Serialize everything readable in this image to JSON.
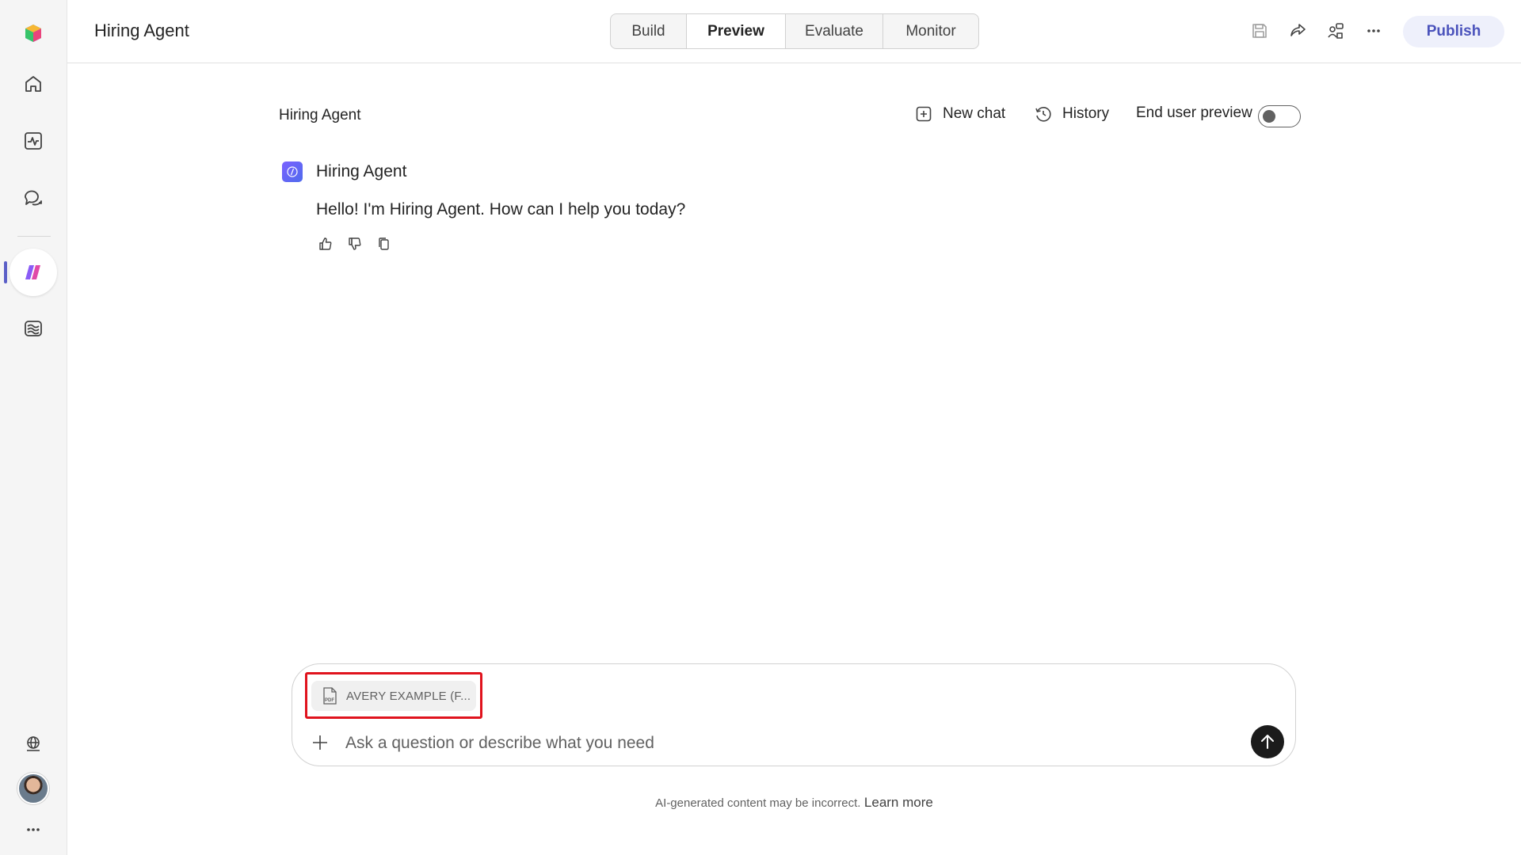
{
  "app": {
    "title": "Hiring Agent"
  },
  "tabs": [
    {
      "label": "Build",
      "active": false
    },
    {
      "label": "Preview",
      "active": true
    },
    {
      "label": "Evaluate",
      "active": false
    },
    {
      "label": "Monitor",
      "active": false
    }
  ],
  "toolbar": {
    "icons": [
      "save-icon",
      "share-icon",
      "connect-icon",
      "more-icon"
    ],
    "publish_label": "Publish"
  },
  "sidebar": {
    "items": [
      "copilot-logo-icon",
      "home-icon",
      "activity-icon",
      "chat-icon",
      "agent-icon",
      "library-icon",
      "globe-icon",
      "avatar",
      "more-icon"
    ],
    "active": "agent-icon"
  },
  "chat_header": {
    "title": "Hiring Agent",
    "new_chat_label": "New chat",
    "history_label": "History",
    "end_user_preview_label": "End user preview",
    "end_user_preview_on": false
  },
  "message": {
    "sender": "Hiring Agent",
    "text": "Hello! I'm Hiring Agent. How can I help you today?"
  },
  "composer": {
    "attachment_name": "AVERY EXAMPLE (F...",
    "attachment_type": "PDF",
    "placeholder": "Ask a question or describe what you need"
  },
  "footer": {
    "disclaimer": "AI-generated content may be incorrect.",
    "learn_more": "Learn more"
  },
  "colors": {
    "accent": "#5b5fc7",
    "publish_bg": "#eef0fb",
    "highlight": "#e0131d"
  }
}
